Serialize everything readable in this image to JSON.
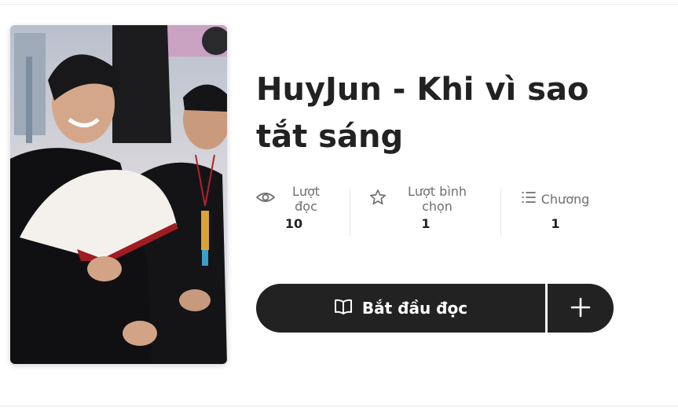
{
  "story": {
    "title": "HuyJun - Khi vì sao tắt sáng"
  },
  "stats": {
    "reads": {
      "icon": "eye-icon",
      "label": "Lượt đọc",
      "value": "10"
    },
    "votes": {
      "icon": "star-icon",
      "label": "Lượt bình chọn",
      "value": "1"
    },
    "parts": {
      "icon": "list-icon",
      "label": "Chương",
      "value": "1"
    }
  },
  "actions": {
    "start_reading": {
      "icon": "book-open-icon",
      "label": "Bắt đầu đọc"
    },
    "add_to_library": {
      "icon": "plus-icon"
    }
  },
  "colors": {
    "button_bg": "#222222",
    "text_primary": "#222222",
    "text_muted": "#6f6f6f",
    "divider": "#e5e5e5"
  }
}
